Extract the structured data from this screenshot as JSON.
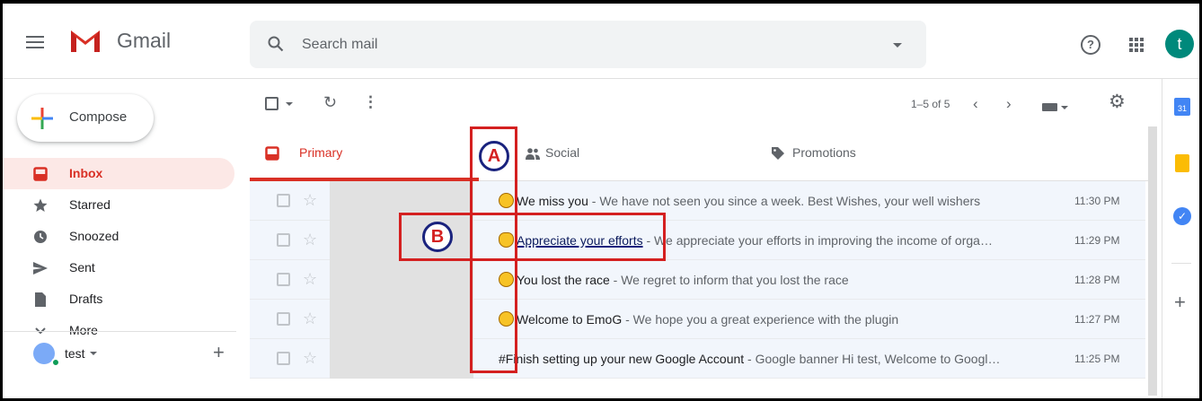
{
  "header": {
    "brand": "Gmail",
    "search_placeholder": "Search mail",
    "help_icon": "?",
    "avatar_letter": "t"
  },
  "sidebar": {
    "compose_label": "Compose",
    "items": [
      {
        "label": "Inbox",
        "icon": "inbox-icon",
        "active": true
      },
      {
        "label": "Starred",
        "icon": "star-icon"
      },
      {
        "label": "Snoozed",
        "icon": "clock-icon"
      },
      {
        "label": "Sent",
        "icon": "send-icon"
      },
      {
        "label": "Drafts",
        "icon": "draft-icon"
      },
      {
        "label": "More",
        "icon": "chevron-down-icon"
      }
    ],
    "user_name": "test"
  },
  "toolbar": {
    "count": "1–5 of 5",
    "prev": "‹",
    "next": "›"
  },
  "tabs": [
    {
      "label": "Primary",
      "icon": "inbox-icon"
    },
    {
      "label": "Social",
      "icon": "people-icon"
    },
    {
      "label": "Promotions",
      "icon": "tag-icon"
    }
  ],
  "emails": [
    {
      "subject": "We miss you",
      "snippet": " - We have not seen you since a week. Best Wishes, your well wishers",
      "time": "11:30 PM",
      "emoji": "sad-face-emoji"
    },
    {
      "subject": "Appreciate your efforts",
      "snippet": " - We appreciate your efforts in improving the income of orga…",
      "time": "11:29 PM",
      "emoji": "clapping-hands-emoji"
    },
    {
      "subject": "You lost the race",
      "snippet": " - We regret to inform that you lost the race",
      "time": "11:28 PM",
      "emoji": "crying-face-emoji"
    },
    {
      "subject": "Welcome to EmoG",
      "snippet": " - We hope you a great experience with the plugin",
      "time": "11:27 PM",
      "emoji": "grinning-face-emoji"
    },
    {
      "subject": "#Finish setting up your new Google Account",
      "snippet": " - Google banner Hi test, Welcome to Googl…",
      "time": "11:25 PM",
      "emoji": null
    }
  ],
  "rail": {
    "calendar_day": "31"
  },
  "annotations": {
    "a_label": "A",
    "b_label": "B",
    "box_color": "#d42020",
    "circle_color": "#1a237e"
  },
  "colors": {
    "accent": "#d93025",
    "avatar": "#00897b"
  }
}
